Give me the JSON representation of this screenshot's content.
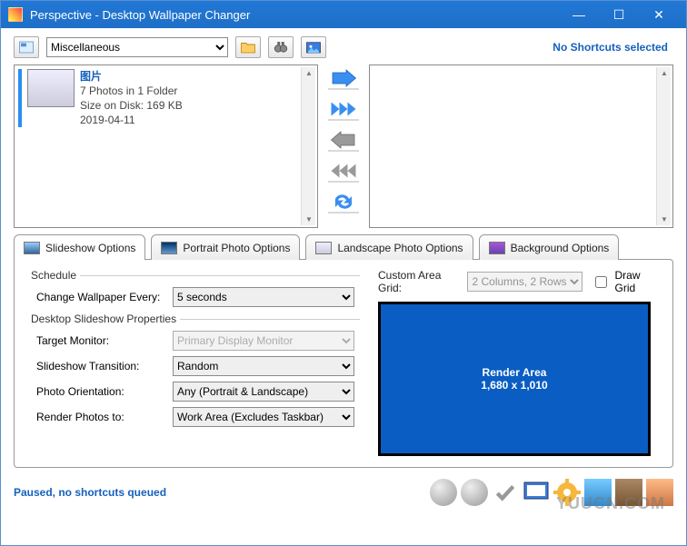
{
  "window": {
    "title": "Perspective - Desktop Wallpaper Changer"
  },
  "toolbar": {
    "category_selected": "Miscellaneous",
    "right_status": "No Shortcuts selected"
  },
  "source_folder": {
    "name": "图片",
    "line2": "7 Photos in 1 Folder",
    "line3": "Size on Disk: 169 KB",
    "line4": "2019-04-11"
  },
  "tabs": {
    "slideshow": "Slideshow Options",
    "portrait": "Portrait Photo Options",
    "landscape": "Landscape Photo Options",
    "background": "Background Options"
  },
  "form": {
    "schedule_legend": "Schedule",
    "change_every_label": "Change Wallpaper Every:",
    "change_every_value": "5 seconds",
    "desktop_legend": "Desktop Slideshow Properties",
    "target_monitor_label": "Target Monitor:",
    "target_monitor_value": "Primary Display Monitor",
    "transition_label": "Slideshow Transition:",
    "transition_value": "Random",
    "orientation_label": "Photo Orientation:",
    "orientation_value": "Any (Portrait & Landscape)",
    "render_to_label": "Render Photos to:",
    "render_to_value": "Work Area (Excludes Taskbar)"
  },
  "grid": {
    "label": "Custom Area Grid:",
    "value": "2 Columns, 2 Rows",
    "draw_grid_label": "Draw Grid"
  },
  "render": {
    "title": "Render Area",
    "dims": "1,680 x 1,010"
  },
  "status": {
    "text": "Paused, no shortcuts queued"
  },
  "watermark": "YUUCN.COM"
}
